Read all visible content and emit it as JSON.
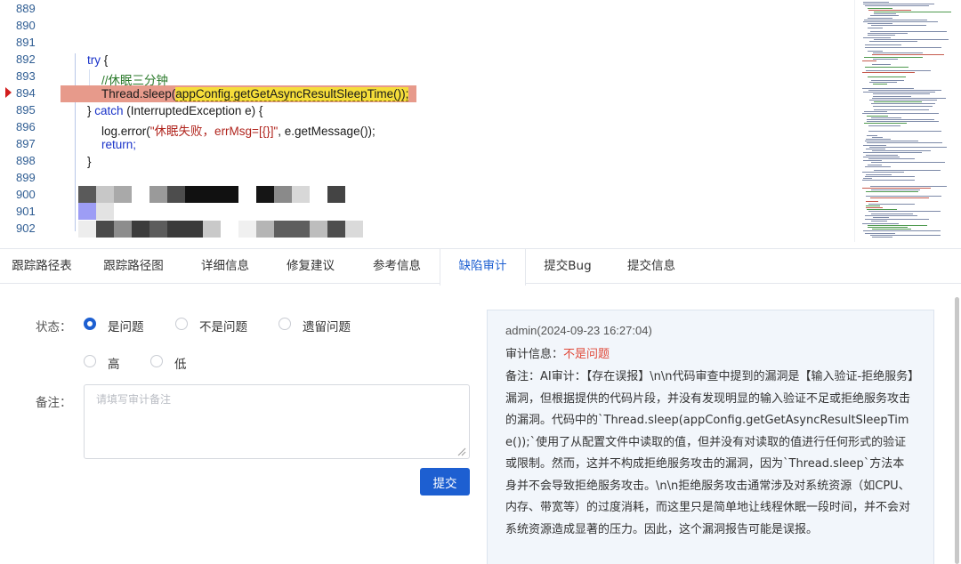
{
  "code": {
    "line_numbers": [
      "889",
      "890",
      "891",
      "892",
      "893",
      "894",
      "895",
      "896",
      "897",
      "898",
      "899",
      "900",
      "901",
      "902"
    ],
    "lines": {
      "l892_kw": "try",
      "l892_rest": " {",
      "l893": "//休眠三分钟",
      "l894_pre": "Thread.sleep(",
      "l894_arg": "appConfig.getGetAsyncResultSleepTime());",
      "l895_pre": "} ",
      "l895_kw": "catch",
      "l895_rest": " (InterruptedException e) {",
      "l896_pre": "log.error(",
      "l896_str": "\"休眠失败，errMsg=[{}]\"",
      "l896_rest": ", e.getMessage());",
      "l897": "return;",
      "l898": "}"
    }
  },
  "tabs": [
    {
      "label": "跟踪路径表"
    },
    {
      "label": "跟踪路径图"
    },
    {
      "label": "详细信息"
    },
    {
      "label": "修复建议"
    },
    {
      "label": "参考信息"
    },
    {
      "label": "缺陷审计",
      "active": true
    },
    {
      "label": "提交Bug"
    },
    {
      "label": "提交信息"
    }
  ],
  "form": {
    "status_label": "状态：",
    "status_options": [
      {
        "label": "是问题",
        "checked": true
      },
      {
        "label": "不是问题",
        "checked": false
      },
      {
        "label": "遗留问题",
        "checked": false
      }
    ],
    "severity_options": [
      {
        "label": "高",
        "checked": false
      },
      {
        "label": "低",
        "checked": false
      }
    ],
    "note_label": "备注：",
    "note_placeholder": "请填写审计备注",
    "note_value": "",
    "submit_label": "提交"
  },
  "audit": {
    "user_time": "admin(2024-09-23 16:27:04)",
    "info_label": "审计信息：",
    "info_value": "不是问题",
    "note": "备注：AI审计：【存在误报】\\n\\n代码审查中提到的漏洞是【输入验证-拒绝服务】漏洞，但根据提供的代码片段，并没有发现明显的输入验证不足或拒绝服务攻击的漏洞。代码中的`Thread.sleep(appConfig.getGetAsyncResultSleepTime());`使用了从配置文件中读取的值，但并没有对读取的值进行任何形式的验证或限制。然而，这并不构成拒绝服务攻击的漏洞，因为`Thread.sleep`方法本身并不会导致拒绝服务攻击。\\n\\n拒绝服务攻击通常涉及对系统资源（如CPU、内存、带宽等）的过度消耗，而这里只是简单地让线程休眠一段时间，并不会对系统资源造成显著的压力。因此，这个漏洞报告可能是误报。"
  },
  "colors": {
    "accent": "#1d5fd1",
    "highlight_line": "#e79a8b",
    "highlight_arg": "#f5dd3a",
    "audit_value": "#e04a3a",
    "audit_bg": "#f2f6fb"
  }
}
